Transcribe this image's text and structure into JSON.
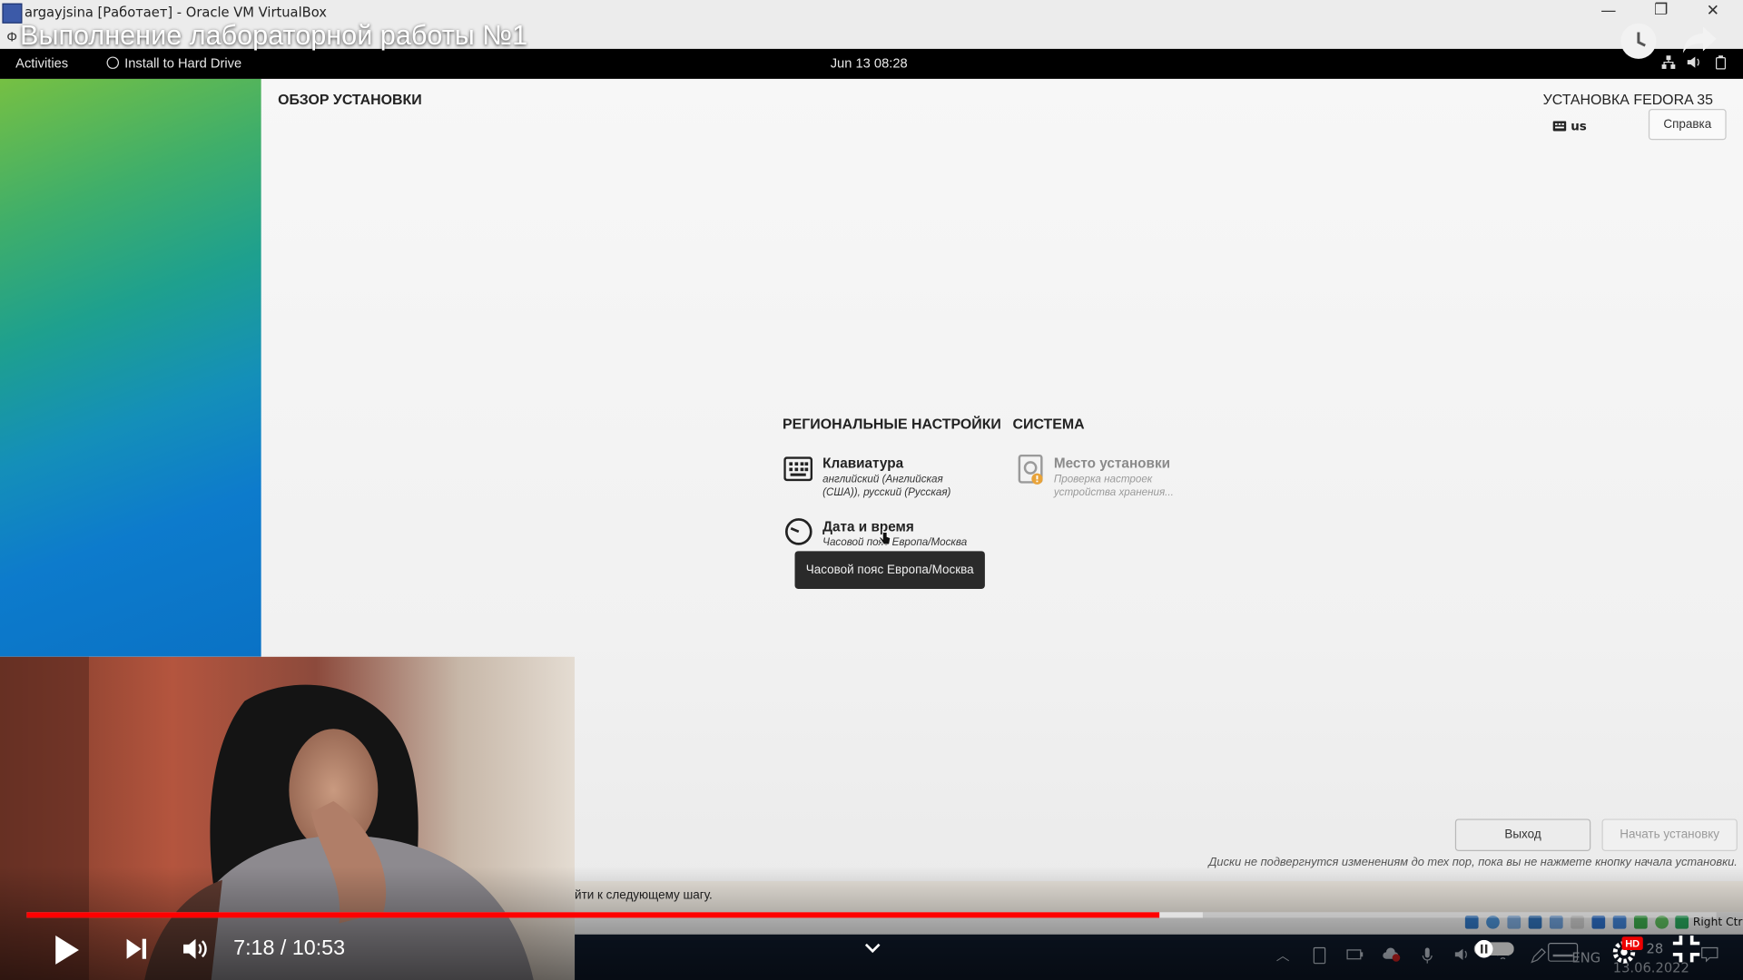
{
  "vbox": {
    "title": "argayjsina [Работает] - Oracle VM VirtualBox",
    "menu_partial": "Ф",
    "status_right_ctrl": "Right Ctrl"
  },
  "youtube": {
    "video_title": "Выполнение лабораторной работы №1",
    "time": "7:18 / 10:53",
    "progress_fraction": 0.6706,
    "buffer_fraction": 0.696,
    "hd_badge": "HD"
  },
  "gnome": {
    "activities": "Activities",
    "install": "Install to Hard Drive",
    "clock": "Jun 13  08:28"
  },
  "anaconda": {
    "page_title": "ОБЗОР УСТАНОВКИ",
    "product_title": "УСТАНОВКА FEDORA 35",
    "keyboard_layout": "us",
    "help_button": "Справка",
    "categories": {
      "localization": "РЕГИОНАЛЬНЫЕ НАСТРОЙКИ",
      "system": "СИСТЕМА"
    },
    "spokes": {
      "keyboard": {
        "title": "Клавиатура",
        "status_line1": "английский (Английская",
        "status_line2": "(США)), русский (Русская)"
      },
      "datetime": {
        "title": "Дата и время",
        "status": "Часовой пояс Европа/Москва"
      },
      "destination": {
        "title": "Место установки",
        "status_line1": "Проверка настроек",
        "status_line2": "устройства хранения..."
      }
    },
    "tooltip": "Часовой пояс Европа/Москва",
    "quit_button": "Выход",
    "begin_button": "Начать установку",
    "notice": "Диски не подвергнутся изменениям до тех пор, пока вы не нажмете кнопку начала установки.",
    "warning_partial": "йти к следующему шагу."
  },
  "taskbar": {
    "lang": "ENG",
    "time_partial": "28",
    "date": "13.06.2022"
  },
  "colors": {
    "yt_red": "#ff0000",
    "gnome_bar": "#000000",
    "taskbar": "#0f1a2b"
  }
}
